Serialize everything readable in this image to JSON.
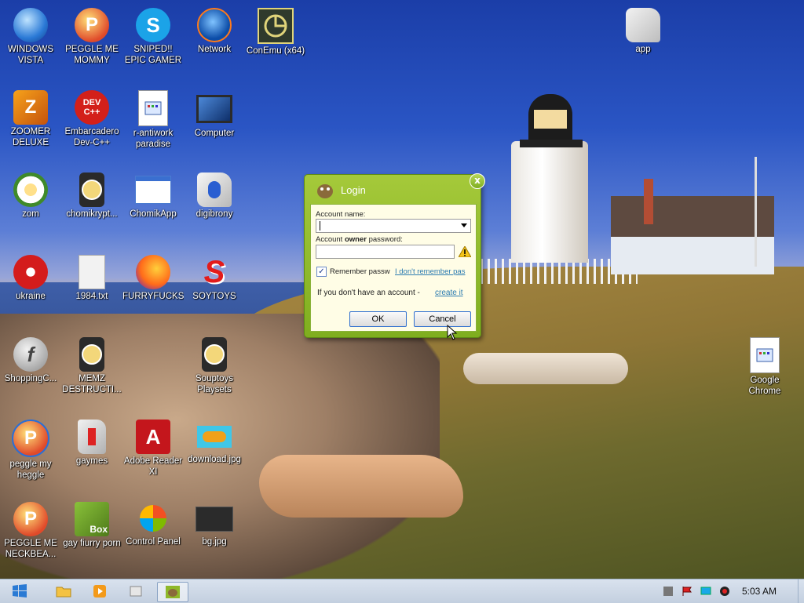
{
  "desktop": {
    "icons": [
      {
        "label": "WINDOWS VISTA"
      },
      {
        "label": "PEGGLE ME MOMMY"
      },
      {
        "label": "SNIPED!! EPIC GAMER 360..."
      },
      {
        "label": "Network"
      },
      {
        "label": "ConEmu (x64)"
      },
      {
        "label": "app"
      },
      {
        "label": "ZOOMER DELUXE"
      },
      {
        "label": "Embarcadero Dev-C++"
      },
      {
        "label": "r-antiwork paradise"
      },
      {
        "label": "Computer"
      },
      {
        "label": "zom"
      },
      {
        "label": "chomikrypt..."
      },
      {
        "label": "ChomikApp"
      },
      {
        "label": "digibrony"
      },
      {
        "label": "ukraine"
      },
      {
        "label": "1984.txt"
      },
      {
        "label": "FURRYFUCKS"
      },
      {
        "label": "SOYTOYS"
      },
      {
        "label": "ShoppingC..."
      },
      {
        "label": "MEMZ DESTRUCTI..."
      },
      {
        "label": "Souptoys Playsets"
      },
      {
        "label": "Google Chrome"
      },
      {
        "label": "peggle my heggle"
      },
      {
        "label": "gaymes"
      },
      {
        "label": "Adobe Reader XI"
      },
      {
        "label": "download.jpg"
      },
      {
        "label": "PEGGLE ME NECKBEA..."
      },
      {
        "label": "gay fiurry porn"
      },
      {
        "label": "Control Panel"
      },
      {
        "label": "bg.jpg"
      }
    ],
    "icon_badges": {
      "devcpp": "DEV C++",
      "box": "Box",
      "peggle": "P",
      "skype": "S"
    }
  },
  "login": {
    "title": "Login",
    "close": "x",
    "account_name_label": "Account name:",
    "password_label_pre": "Account ",
    "password_label_bold": "owner",
    "password_label_post": " password:",
    "remember_label": "Remember passw",
    "forgot_link": "I don't remember pas",
    "no_account_text": "If you don't have an account - ",
    "create_link": "create it",
    "ok": "OK",
    "cancel": "Cancel",
    "remember_checked": true
  },
  "taskbar": {
    "clock": "5:03 AM"
  },
  "colors": {
    "dialog_green": "#8fb829",
    "taskbar": "#cdd8e6"
  }
}
